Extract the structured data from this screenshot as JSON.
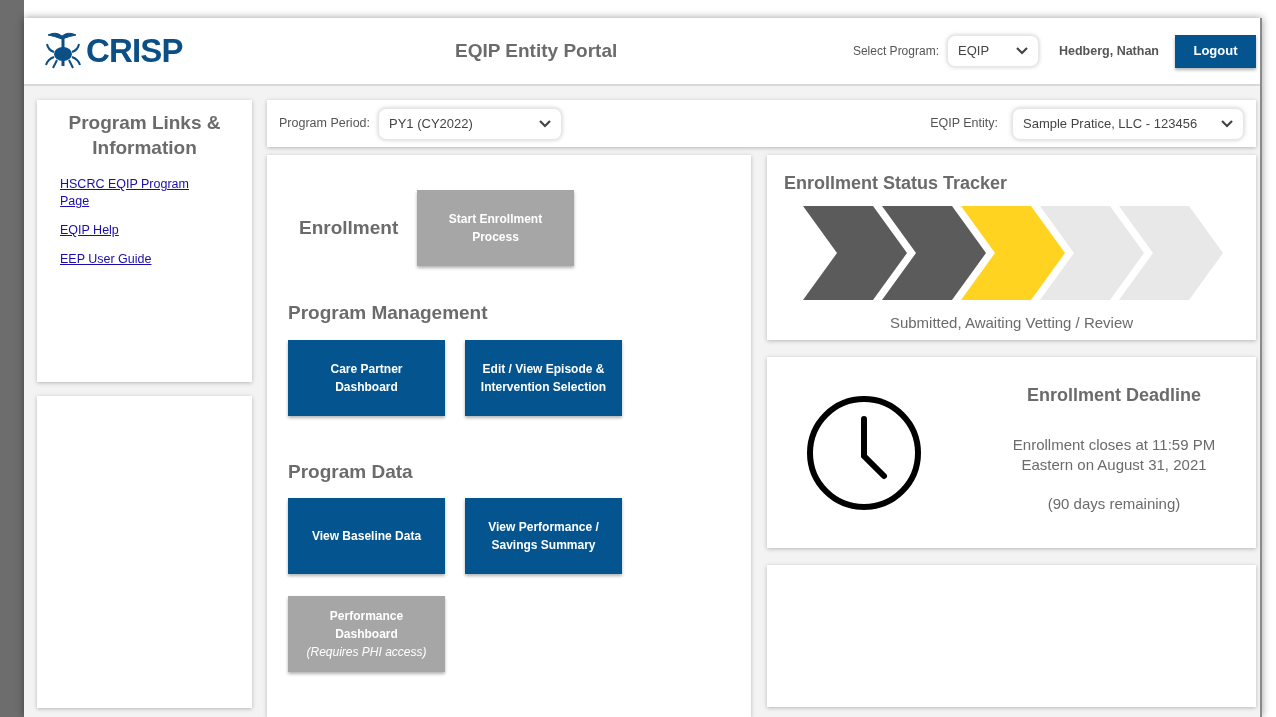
{
  "header": {
    "logo_text": "CRISP",
    "title": "EQIP Entity Portal",
    "program_select": {
      "label": "Select Program:",
      "value": "EQIP"
    },
    "user_name": "Hedberg, Nathan",
    "logout_button": "Logout"
  },
  "sidebar": {
    "title": "Program Links & Information",
    "links": [
      "HSCRC EQIP Program Page",
      "EQIP Help",
      "EEP User Guide"
    ]
  },
  "filters": {
    "program_period": {
      "label": "Program Period:",
      "value": "PY1 (CY2022)"
    },
    "entity": {
      "label": "EQIP Entity:",
      "value": "Sample Pratice, LLC - 123456"
    }
  },
  "sections": [
    {
      "kind": "inline",
      "title": "Enrollment",
      "buttons": [
        {
          "label": "Start Enrollment Process",
          "disabled": true
        }
      ]
    },
    {
      "kind": "stacked",
      "title": "Program Management",
      "buttons": [
        {
          "label": "Care Partner Dashboard",
          "disabled": false
        },
        {
          "label": "Edit / View Episode & Intervention Selection",
          "disabled": false
        }
      ]
    },
    {
      "kind": "stacked",
      "title": "Program Data",
      "buttons": [
        {
          "label": "View Baseline Data",
          "disabled": false
        },
        {
          "label": "View Performance / Savings Summary",
          "disabled": false
        },
        {
          "label": "Performance Dashboard",
          "note": "(Requires PHI access)",
          "disabled": true
        }
      ]
    }
  ],
  "tracker": {
    "title": "Enrollment Status Tracker",
    "steps": [
      {
        "complete": true,
        "selected": false
      },
      {
        "complete": true,
        "selected": false
      },
      {
        "complete": false,
        "selected": true
      },
      {
        "complete": false,
        "selected": false
      },
      {
        "complete": false,
        "selected": false
      }
    ],
    "status": "Submitted, Awaiting Vetting / Review"
  },
  "deadline": {
    "title": "Enrollment Deadline",
    "message": "Enrollment closes at 11:59 PM Eastern on August 31, 2021",
    "remaining": "(90 days remaining)"
  }
}
